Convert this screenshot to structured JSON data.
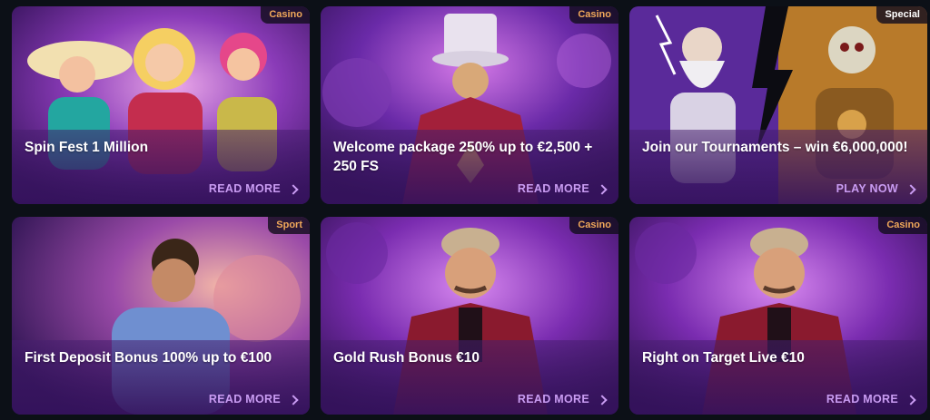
{
  "promotions": [
    {
      "title": "Spin Fest 1 Million",
      "badge": "Casino",
      "cta": "READ MORE",
      "art": "three-women-casino-illustration"
    },
    {
      "title": "Welcome package 250% up to €2,500 + 250 FS",
      "badge": "Casino",
      "cta": "READ MORE",
      "art": "top-hat-magician-illustration"
    },
    {
      "title": "Join our Tournaments – win €6,000,000!",
      "badge": "Special",
      "cta": "PLAY NOW",
      "art": "zeus-vs-hades-illustration"
    },
    {
      "title": "First Deposit Bonus 100% up to €100",
      "badge": "Sport",
      "cta": "READ MORE",
      "art": "football-player-illustration"
    },
    {
      "title": "Gold Rush Bonus €10",
      "badge": "Casino",
      "cta": "READ MORE",
      "art": "mustached-man-illustration"
    },
    {
      "title": "Right on Target Live €10",
      "badge": "Casino",
      "cta": "READ MORE",
      "art": "mustached-man-illustration"
    }
  ],
  "colors": {
    "page_bg": "#0c1017",
    "card_bg": "#2a0f4a",
    "cta": "#c99cf2",
    "badge_text": "#f0a85a"
  }
}
